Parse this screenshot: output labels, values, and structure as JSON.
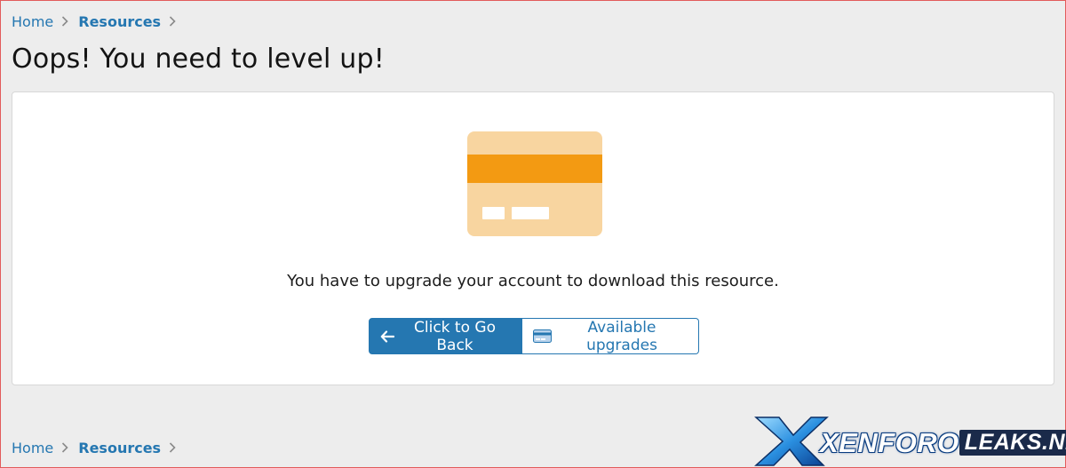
{
  "breadcrumb": {
    "home": "Home",
    "resources": "Resources"
  },
  "page": {
    "title": "Oops! You need to level up!"
  },
  "panel": {
    "message": "You have to upgrade your account to download this resource.",
    "illustration_icon": "credit-card-icon",
    "buttons": {
      "back_label": "Click to Go Back",
      "back_icon": "arrow-left-icon",
      "upgrades_label": "Available upgrades",
      "upgrades_icon": "credit-card-icon"
    }
  },
  "watermark": {
    "prefix": "XENFORO",
    "suffix": "LEAKS.NET"
  },
  "colors": {
    "accent": "#2577b1",
    "card_body": "#f8d5a0",
    "card_stripe": "#f39a12",
    "background": "#ededed"
  }
}
